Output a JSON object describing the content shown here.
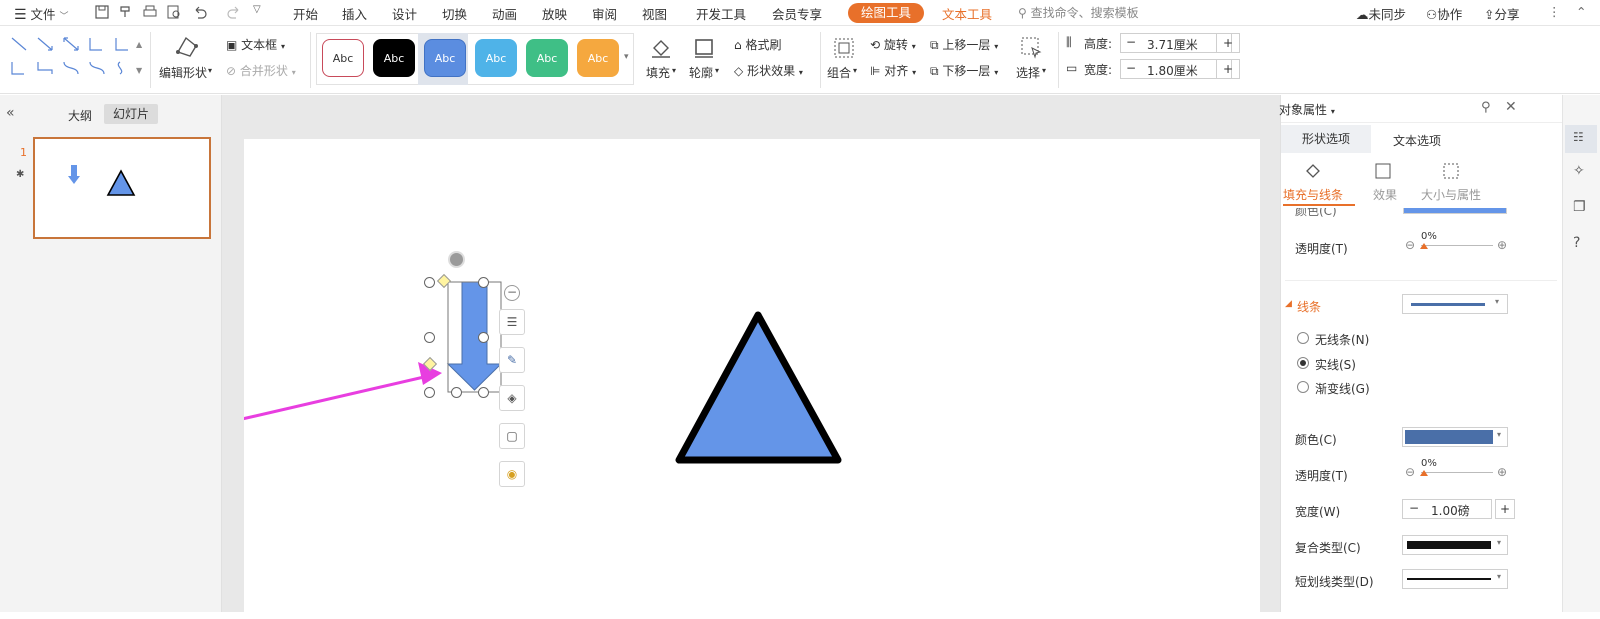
{
  "menubar": {
    "file_label": "文件",
    "tabs": [
      "开始",
      "插入",
      "设计",
      "切换",
      "动画",
      "放映",
      "审阅",
      "视图",
      "开发工具",
      "会员专享"
    ],
    "active_tab": "绘图工具",
    "text_tool_tab": "文本工具",
    "search_placeholder": "查找命令、搜索模板",
    "sync_label": "未同步",
    "collab_label": "协作",
    "share_label": "分享"
  },
  "ribbon": {
    "edit_shape": "编辑形状",
    "text_box": "文本框",
    "merge_shape": "合并形状",
    "style_label": "Abc",
    "fill": "填充",
    "outline": "轮廓",
    "format_painter": "格式刷",
    "shape_effect": "形状效果",
    "group": "组合",
    "rotate": "旋转",
    "align": "对齐",
    "bring_forward": "上移一层",
    "send_backward": "下移一层",
    "select": "选择",
    "height_label": "高度:",
    "height_value": "3.71厘米",
    "width_label": "宽度:",
    "width_value": "1.80厘米"
  },
  "colors": {
    "accent": "#e8702a",
    "shape_fill": "#6495e8",
    "magenta_arrow": "#e83ee0",
    "line_color": "#4a6fa8"
  },
  "leftpanel": {
    "outline_tab": "大纲",
    "slides_tab": "幻灯片",
    "slide_number": "1"
  },
  "rightpanel": {
    "title": "对象属性",
    "tab_shape": "形状选项",
    "tab_text": "文本选项",
    "sub_fill_line": "填充与线条",
    "sub_effect": "效果",
    "sub_size": "大小与属性",
    "color_partial": "颜色(C)",
    "transparency": "透明度(T)",
    "transparency_value": "0%",
    "line_section": "线条",
    "no_line": "无线条(N)",
    "solid_line": "实线(S)",
    "gradient_line": "渐变线(G)",
    "color": "颜色(C)",
    "transparency2": "透明度(T)",
    "transparency2_value": "0%",
    "width": "宽度(W)",
    "width_value": "1.00磅",
    "compound_type": "复合类型(C)",
    "dash_type": "短划线类型(D)"
  }
}
